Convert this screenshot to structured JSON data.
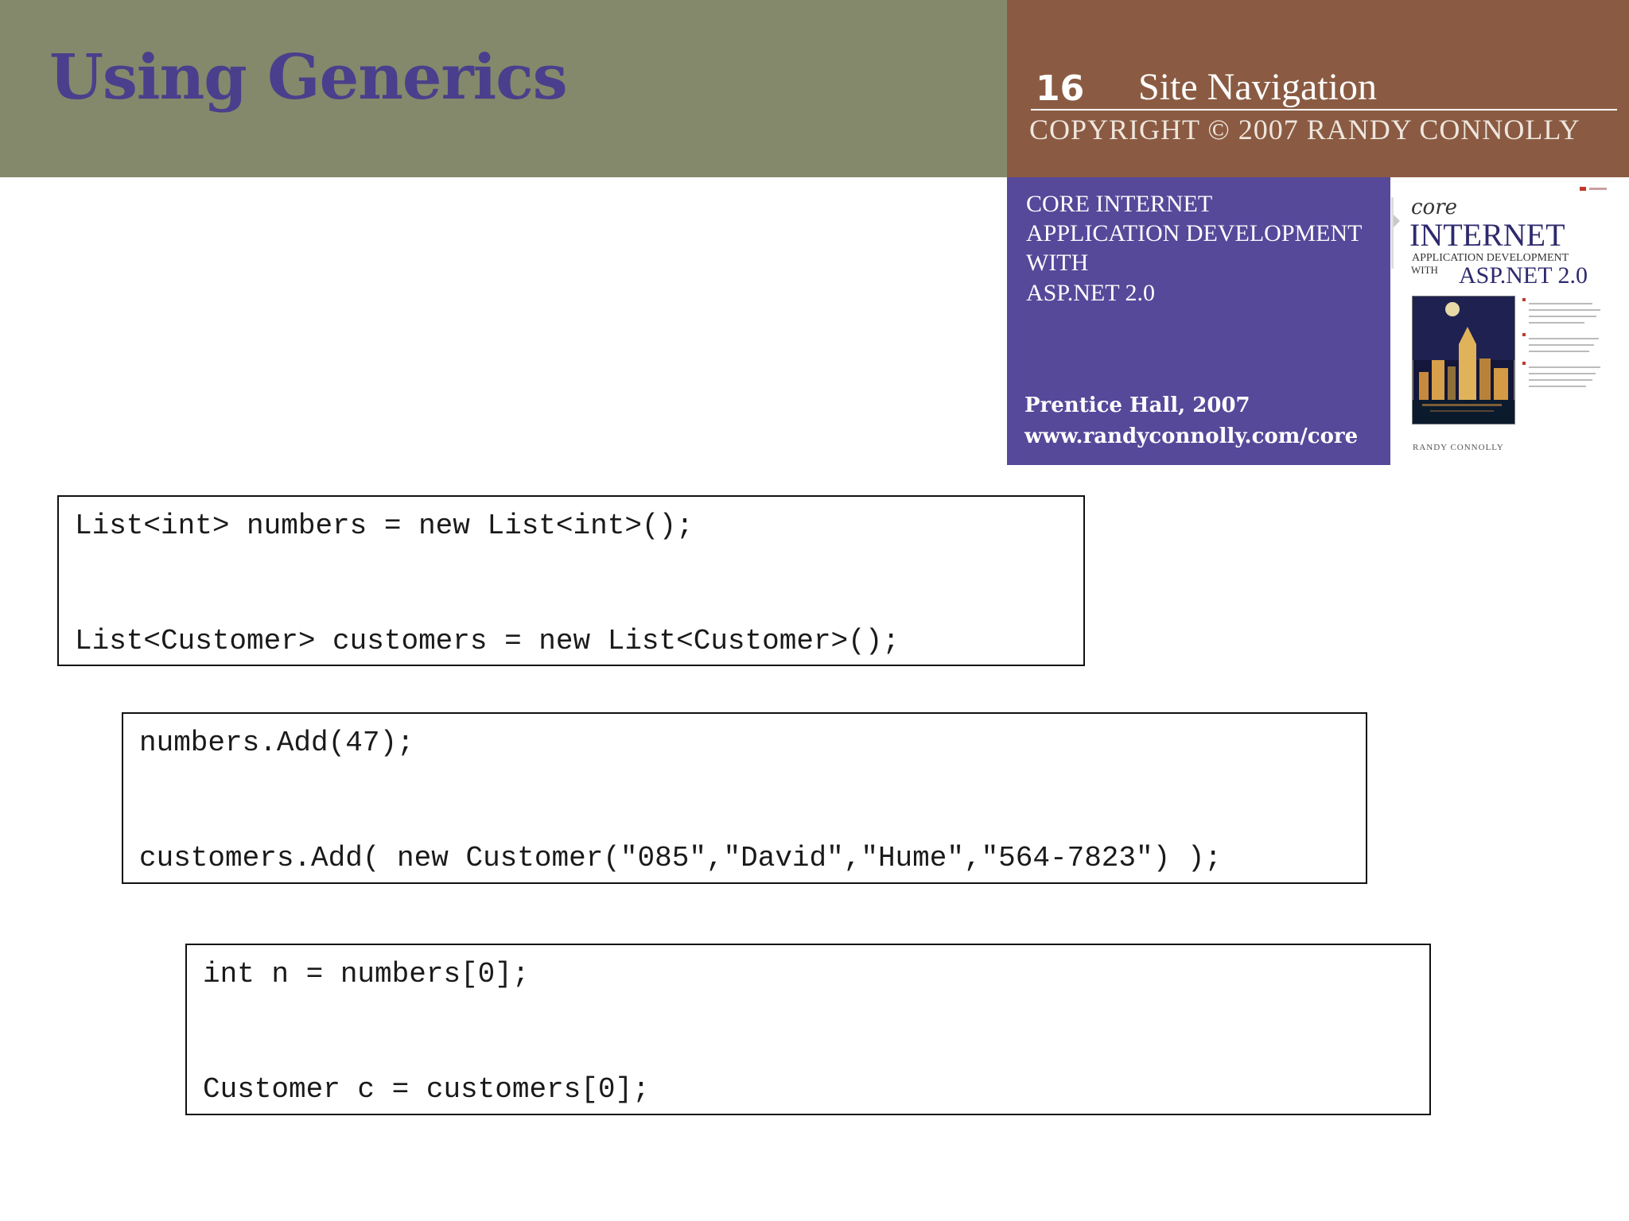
{
  "header": {
    "title": "Using Generics",
    "slide_number": "16",
    "section": "Site Navigation",
    "copyright": "COPYRIGHT © 2007 RANDY CONNOLLY"
  },
  "book": {
    "title_lines": [
      "CORE INTERNET",
      "APPLICATION DEVELOPMENT",
      "WITH",
      "ASP.NET 2.0"
    ],
    "publisher": "Prentice Hall, 2007",
    "url": "www.randyconnolly.com/core",
    "cover": {
      "brand": "core",
      "title": "INTERNET",
      "subtitle_1": "APPLICATION DEVELOPMENT",
      "subtitle_with": "WITH",
      "subtitle_2": "ASP.NET 2.0",
      "author": "RANDY CONNOLLY"
    }
  },
  "code_blocks": [
    {
      "line1": "List<int> numbers = new List<int>();",
      "line2": "List<Customer> customers = new List<Customer>();"
    },
    {
      "line1": "numbers.Add(47);",
      "line2": "customers.Add( new Customer(\"085\",\"David\",\"Hume\",\"564-7823\") );"
    },
    {
      "line1": "int n = numbers[0];",
      "line2": "Customer c = customers[0];"
    }
  ],
  "colors": {
    "title_bar": "#84896b",
    "header_bar": "#8a5b42",
    "book_panel": "#56499a",
    "title_text": "#4a3f8c"
  }
}
